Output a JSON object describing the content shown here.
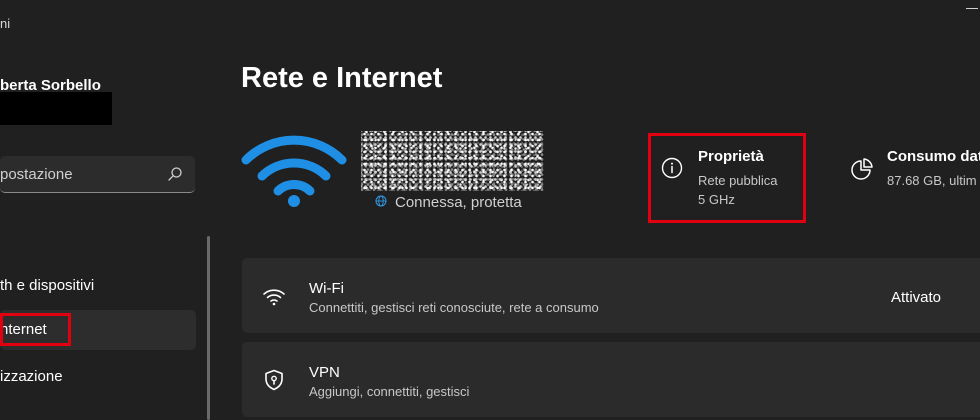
{
  "window": {
    "title_fragment": "ni"
  },
  "sidebar": {
    "user_name": "berta Sorbello",
    "search": {
      "placeholder": "postazione"
    },
    "items": [
      {
        "label": "th e dispositivi"
      },
      {
        "label": "nternet"
      },
      {
        "label": "izzazione"
      }
    ]
  },
  "main": {
    "page_title": "Rete e Internet",
    "network": {
      "name": "",
      "status": "Connessa, protetta"
    },
    "properties": {
      "title": "Proprietà",
      "network_type": "Rete pubblica",
      "band": "5 GHz"
    },
    "data_usage": {
      "title": "Consumo dat",
      "detail": "87.68 GB, ultim"
    },
    "cards": [
      {
        "title": "Wi-Fi",
        "subtitle": "Connettiti, gestisci reti conosciute, rete a consumo",
        "state": "Attivato",
        "icon": "wifi-icon"
      },
      {
        "title": "VPN",
        "subtitle": "Aggiungi, connettiti, gestisci",
        "icon": "vpn-shield-icon"
      }
    ]
  },
  "colors": {
    "background": "#202020",
    "card": "#2b2b2b",
    "accent": "#0078d4",
    "annotation": "#e0000f"
  }
}
